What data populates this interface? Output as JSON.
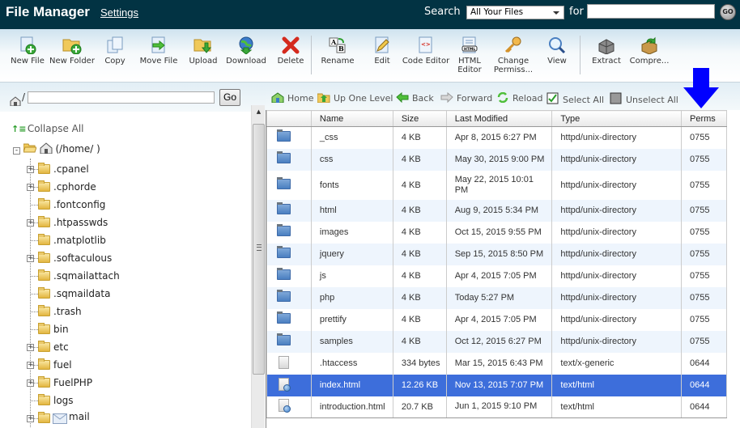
{
  "header": {
    "title": "File Manager",
    "settings_label": "Settings",
    "search_label": "Search",
    "search_scope": "All Your Files",
    "for_label": "for",
    "search_value": "",
    "go_label": "GO"
  },
  "toolbar": {
    "buttons": [
      {
        "label": "New File",
        "icon": "new-file-icon"
      },
      {
        "label": "New Folder",
        "icon": "new-folder-icon"
      },
      {
        "label": "Copy",
        "icon": "copy-icon"
      },
      {
        "label": "Move File",
        "icon": "move-file-icon"
      },
      {
        "label": "Upload",
        "icon": "upload-icon"
      },
      {
        "label": "Download",
        "icon": "download-icon"
      },
      {
        "label": "Delete",
        "icon": "delete-icon"
      },
      {
        "label": "Rename",
        "icon": "rename-icon"
      },
      {
        "label": "Edit",
        "icon": "edit-icon"
      },
      {
        "label": "Code Editor",
        "icon": "code-editor-icon"
      },
      {
        "label": "HTML Editor",
        "icon": "html-editor-icon"
      },
      {
        "label": "Change Permiss...",
        "icon": "key-icon"
      },
      {
        "label": "View",
        "icon": "magnifier-icon"
      },
      {
        "label": "Extract",
        "icon": "extract-icon"
      },
      {
        "label": "Compre...",
        "icon": "compress-icon"
      }
    ]
  },
  "left": {
    "path_slash": "/",
    "path_value": "",
    "go_label": "Go",
    "collapse_all": "Collapse All",
    "root_label": "(/home/        )",
    "tree": [
      {
        "label": ".cpanel",
        "expandable": true
      },
      {
        "label": ".cphorde",
        "expandable": true
      },
      {
        "label": ".fontconfig",
        "expandable": false
      },
      {
        "label": ".htpasswds",
        "expandable": true
      },
      {
        "label": ".matplotlib",
        "expandable": false
      },
      {
        "label": ".softaculous",
        "expandable": true
      },
      {
        "label": ".sqmailattach",
        "expandable": false
      },
      {
        "label": ".sqmaildata",
        "expandable": false
      },
      {
        "label": ".trash",
        "expandable": false
      },
      {
        "label": "bin",
        "expandable": false
      },
      {
        "label": "etc",
        "expandable": true
      },
      {
        "label": "fuel",
        "expandable": true
      },
      {
        "label": "FuelPHP",
        "expandable": true
      },
      {
        "label": "logs",
        "expandable": false
      },
      {
        "label": "mail",
        "expandable": true
      }
    ]
  },
  "nav": {
    "home": "Home",
    "up": "Up One Level",
    "back": "Back",
    "forward": "Forward",
    "reload": "Reload",
    "select_all": "Select All",
    "unselect_all": "Unselect All"
  },
  "table": {
    "columns": [
      "",
      "Name",
      "Size",
      "Last Modified",
      "Type",
      "Perms"
    ],
    "rows": [
      {
        "icon": "folder",
        "name": "_css",
        "size": "4 KB",
        "modified": "Apr 8, 2015 6:27 PM",
        "type": "httpd/unix-directory",
        "perms": "0755"
      },
      {
        "icon": "folder",
        "name": "css",
        "size": "4 KB",
        "modified": "May 30, 2015 9:00 PM",
        "type": "httpd/unix-directory",
        "perms": "0755"
      },
      {
        "icon": "folder",
        "name": "fonts",
        "size": "4 KB",
        "modified": "May 22, 2015 10:01 PM",
        "type": "httpd/unix-directory",
        "perms": "0755"
      },
      {
        "icon": "folder",
        "name": "html",
        "size": "4 KB",
        "modified": "Aug 9, 2015 5:34 PM",
        "type": "httpd/unix-directory",
        "perms": "0755"
      },
      {
        "icon": "folder",
        "name": "images",
        "size": "4 KB",
        "modified": "Oct 15, 2015 9:55 PM",
        "type": "httpd/unix-directory",
        "perms": "0755"
      },
      {
        "icon": "folder",
        "name": "jquery",
        "size": "4 KB",
        "modified": "Sep 15, 2015 8:50 PM",
        "type": "httpd/unix-directory",
        "perms": "0755"
      },
      {
        "icon": "folder",
        "name": "js",
        "size": "4 KB",
        "modified": "Apr 4, 2015 7:05 PM",
        "type": "httpd/unix-directory",
        "perms": "0755"
      },
      {
        "icon": "folder",
        "name": "php",
        "size": "4 KB",
        "modified": "Today 5:27 PM",
        "type": "httpd/unix-directory",
        "perms": "0755"
      },
      {
        "icon": "folder",
        "name": "prettify",
        "size": "4 KB",
        "modified": "Apr 4, 2015 7:05 PM",
        "type": "httpd/unix-directory",
        "perms": "0755"
      },
      {
        "icon": "folder",
        "name": "samples",
        "size": "4 KB",
        "modified": "Oct 12, 2015 6:27 PM",
        "type": "httpd/unix-directory",
        "perms": "0755"
      },
      {
        "icon": "text",
        "name": ".htaccess",
        "size": "334 bytes",
        "modified": "Mar 15, 2015 6:43 PM",
        "type": "text/x-generic",
        "perms": "0644"
      },
      {
        "icon": "html",
        "name": "index.html",
        "size": "12.26 KB",
        "modified": "Nov 13, 2015 7:07 PM",
        "type": "text/html",
        "perms": "0644",
        "selected": true
      },
      {
        "icon": "html",
        "name": "introduction.html",
        "size": "20.7 KB",
        "modified": "Jun 1, 2015 9:10 PM",
        "type": "text/html",
        "perms": "0644"
      }
    ]
  },
  "colors": {
    "header_bg": "#023343",
    "selected_row": "#3d6edb",
    "alt_row": "#eef5fd",
    "annotation_arrow": "#0000ff"
  }
}
